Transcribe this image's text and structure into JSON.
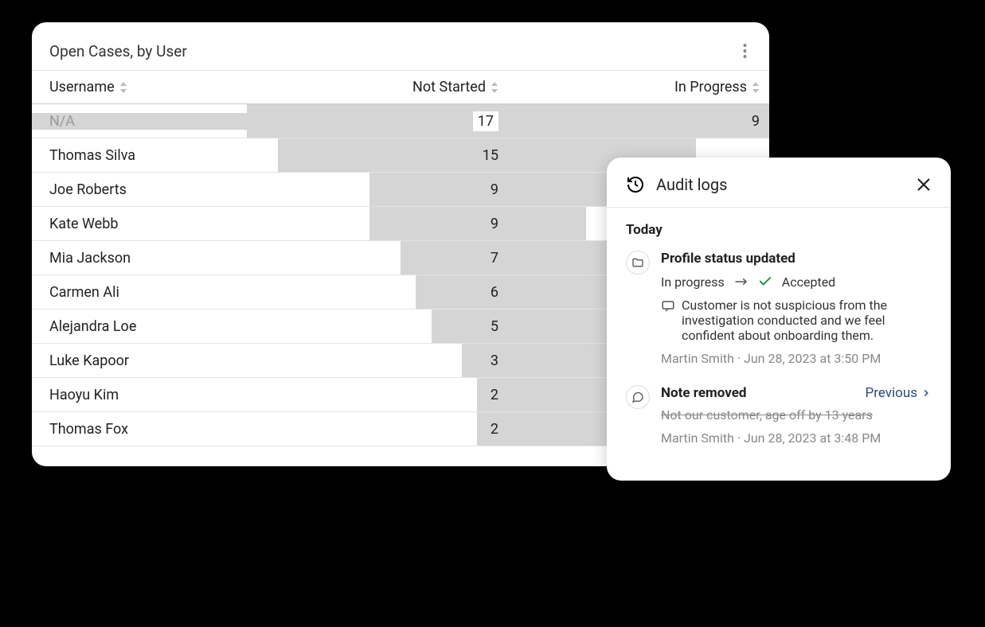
{
  "table": {
    "title": "Open Cases, by User",
    "columns": {
      "user": "Username",
      "not_started": "Not Started",
      "in_progress": "In Progress"
    },
    "max_not_started": 17,
    "rows": [
      {
        "user": "N/A",
        "not_started": 17,
        "in_progress": 9,
        "na": true,
        "selected": true
      },
      {
        "user": "Thomas Silva",
        "not_started": 15
      },
      {
        "user": "Joe Roberts",
        "not_started": 9
      },
      {
        "user": "Kate Webb",
        "not_started": 9
      },
      {
        "user": "Mia Jackson",
        "not_started": 7
      },
      {
        "user": "Carmen Ali",
        "not_started": 6
      },
      {
        "user": "Alejandra Loe",
        "not_started": 5
      },
      {
        "user": "Luke Kapoor",
        "not_started": 3
      },
      {
        "user": "Haoyu Kim",
        "not_started": 2
      },
      {
        "user": "Thomas Fox",
        "not_started": 2
      }
    ]
  },
  "audit": {
    "title": "Audit logs",
    "section": "Today",
    "previous_label": "Previous",
    "items": [
      {
        "kind": "status",
        "title": "Profile status updated",
        "from": "In progress",
        "to": "Accepted",
        "note": "Customer is not suspicious from the investigation conducted and we feel confident about onboarding them.",
        "author": "Martin Smith",
        "time": "Jun 28, 2023 at 3:50 PM"
      },
      {
        "kind": "note_removed",
        "title": "Note removed",
        "removed_text": "Not our customer, age off by 13 years",
        "author": "Martin Smith",
        "time": "Jun 28, 2023 at 3:48 PM",
        "show_previous": true
      }
    ]
  },
  "chart_data": {
    "type": "bar",
    "title": "Open Cases, by User",
    "categories": [
      "N/A",
      "Thomas Silva",
      "Joe Roberts",
      "Kate Webb",
      "Mia Jackson",
      "Carmen Ali",
      "Alejandra Loe",
      "Luke Kapoor",
      "Haoyu Kim",
      "Thomas Fox"
    ],
    "series": [
      {
        "name": "Not Started",
        "values": [
          17,
          15,
          9,
          9,
          7,
          6,
          5,
          3,
          2,
          2
        ]
      },
      {
        "name": "In Progress",
        "values": [
          9,
          null,
          null,
          null,
          null,
          null,
          null,
          null,
          null,
          null
        ]
      }
    ]
  }
}
